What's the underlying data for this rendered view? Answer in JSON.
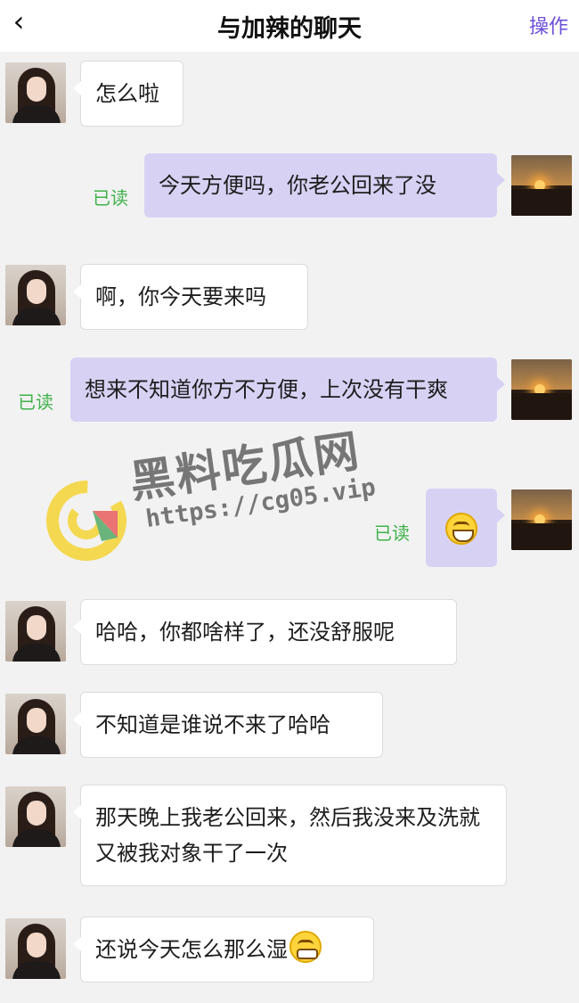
{
  "header": {
    "back_icon": "chevron-left-icon",
    "title": "与加辣的聊天",
    "action_label": "操作"
  },
  "messages": [
    {
      "sender": "her",
      "text": "怎么啦"
    },
    {
      "sender": "me",
      "text": "今天方便吗，你老公回来了没",
      "status": "已读"
    },
    {
      "sender": "her",
      "text": "啊，你今天要来吗"
    },
    {
      "sender": "me",
      "text": "想来不知道你方不方便，上次没有干爽",
      "status": "已读"
    },
    {
      "sender": "me",
      "emoji": "grinning-face-icon",
      "status": "已读"
    },
    {
      "sender": "her",
      "text": "哈哈，你都啥样了，还没舒服呢"
    },
    {
      "sender": "her",
      "text": "不知道是谁说不来了哈哈"
    },
    {
      "sender": "her",
      "text": "那天晚上我老公回来，然后我没来及洗就又被我对象干了一次"
    },
    {
      "sender": "her",
      "text": "还说今天怎么那么湿",
      "emoji": "grimacing-face-icon"
    }
  ],
  "watermark": {
    "name": "黑料吃瓜网",
    "url": "https://cg05.vip"
  },
  "colors": {
    "accent": "#6b4fd8",
    "my_bubble": "#d7d2f4",
    "read_status": "#3fb24a",
    "background": "#f2f2f2"
  }
}
